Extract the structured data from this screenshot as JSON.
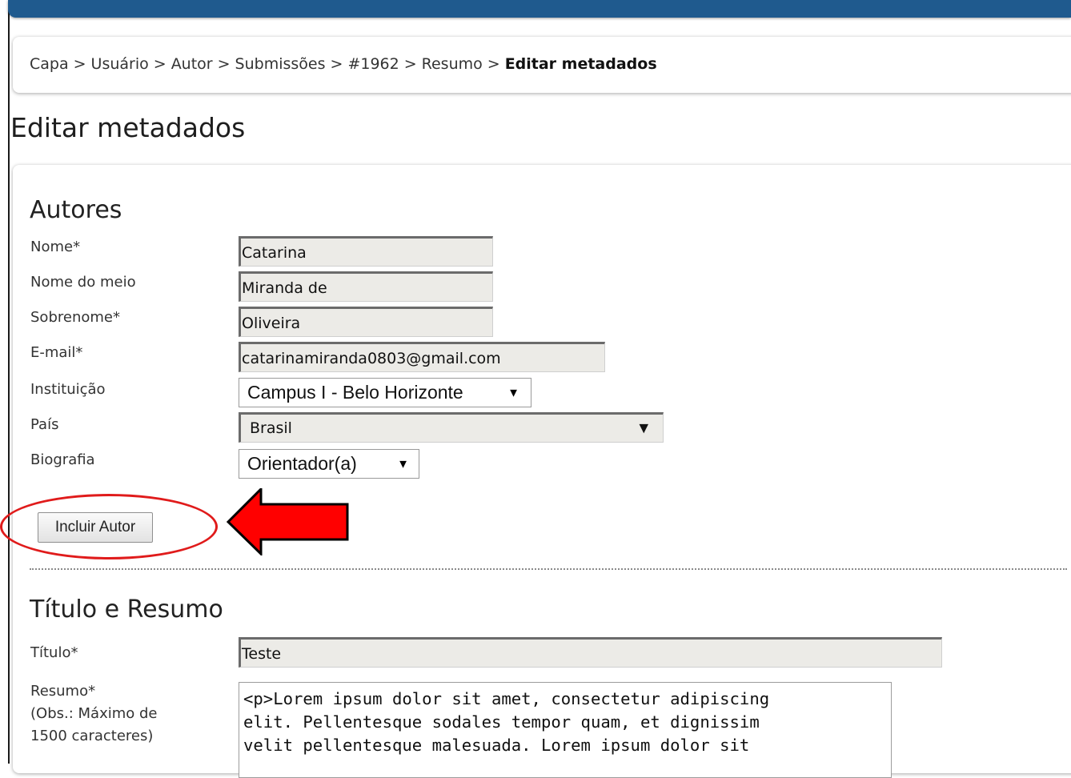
{
  "breadcrumb": {
    "items": [
      "Capa",
      "Usuário",
      "Autor",
      "Submissões",
      "#1962",
      "Resumo"
    ],
    "current": "Editar metadados",
    "separator": ">"
  },
  "page_title": "Editar metadados",
  "authors": {
    "section_title": "Autores",
    "labels": {
      "first_name": "Nome*",
      "middle_name": "Nome do meio",
      "last_name": "Sobrenome*",
      "email": "E-mail*",
      "institution": "Instituição",
      "country": "País",
      "biography": "Biografia"
    },
    "values": {
      "first_name": "Catarina",
      "middle_name": "Miranda de",
      "last_name": "Oliveira",
      "email": "catarinamiranda0803@gmail.com",
      "institution": "Campus I - Belo Horizonte",
      "country": "Brasil",
      "biography": "Orientador(a)"
    },
    "add_author_button": "Incluir Autor"
  },
  "title_abstract": {
    "section_title": "Título e Resumo",
    "labels": {
      "title": "Título*",
      "abstract": "Resumo*",
      "abstract_note_1": "(Obs.: Máximo de",
      "abstract_note_2": "1500 caracteres)"
    },
    "values": {
      "title": "Teste",
      "abstract_lines": [
        "<p>Lorem ipsum dolor sit amet, consectetur adipiscing",
        "elit. Pellentesque sodales tempor quam, et dignissim",
        "velit pellentesque malesuada. Lorem ipsum dolor sit"
      ]
    }
  },
  "colors": {
    "top_bar": "#1f5a8e",
    "annotation_red": "#e01b1b",
    "input_bg": "#ecebe7"
  },
  "icons": {
    "dropdown": "dropdown-arrow-icon",
    "annotation_arrow": "red-arrow-icon"
  }
}
